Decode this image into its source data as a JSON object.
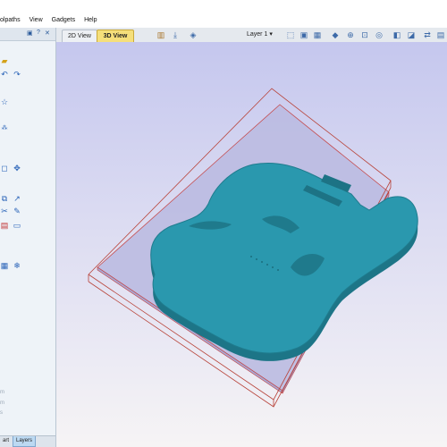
{
  "menu": [
    "olpaths",
    "View",
    "Gadgets",
    "Help"
  ],
  "panel_header": {
    "help": "?"
  },
  "view_tabs": {
    "tab_2d": "2D View",
    "tab_3d": "3D View"
  },
  "layer_selector": {
    "label": "Layer 1",
    "arrow": "▾"
  },
  "left_faint_text": [
    "m",
    "m",
    "s"
  ],
  "bottom_tabs": {
    "part": "art",
    "layers": "Layers"
  },
  "colors": {
    "model": "#2a96ad",
    "model_dark": "#1e7a8e",
    "material": "#b8b8de",
    "box_line": "#c44040",
    "active_tab": "#f5df7a"
  },
  "icons": [
    "open-file-icon",
    "undo-icon",
    "redo-icon",
    "star-icon",
    "transform-icon",
    "node-edit-icon",
    "scissors-icon",
    "ruler-icon",
    "snowflake-icon",
    "3d-view-icon",
    "zoom-icon",
    "layers-icon"
  ]
}
